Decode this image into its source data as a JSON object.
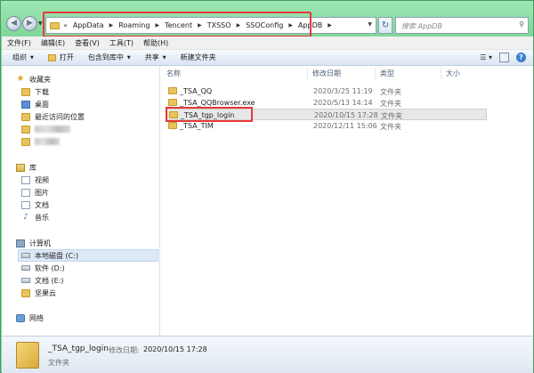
{
  "address": {
    "crumbs": [
      "AppData",
      "Roaming",
      "Tencent",
      "TXSSO",
      "SSOConfig",
      "AppDB"
    ],
    "search_placeholder": "搜索 AppDB"
  },
  "menubar": [
    "文件(F)",
    "编辑(E)",
    "查看(V)",
    "工具(T)",
    "帮助(H)"
  ],
  "toolbar": {
    "organize": "组织",
    "open": "打开",
    "include_in_library": "包含到库中",
    "share": "共享",
    "new_folder": "新建文件夹"
  },
  "nav": {
    "favorites": "收藏夹",
    "downloads": "下载",
    "desktop": "桌面",
    "recent": "最近访问的位置",
    "libraries": "库",
    "videos": "视频",
    "pictures": "图片",
    "documents": "文档",
    "music": "音乐",
    "computer": "计算机",
    "drive_c": "本地磁盘 (C:)",
    "drive_d": "软件 (D:)",
    "drive_e": "文档 (E:)",
    "nutstore": "坚果云",
    "network": "网络"
  },
  "columns": {
    "name": "名称",
    "modified": "修改日期",
    "type": "类型",
    "size": "大小"
  },
  "files": [
    {
      "name": "_TSA_QQ",
      "modified": "2020/3/25 11:19",
      "type": "文件夹"
    },
    {
      "name": "_TSA_QQBrowser.exe",
      "modified": "2020/5/13 14:14",
      "type": "文件夹"
    },
    {
      "name": "_TSA_tgp_login",
      "modified": "2020/10/15 17:28",
      "type": "文件夹",
      "selected": true
    },
    {
      "name": "_TSA_TIM",
      "modified": "2020/12/11 15:06",
      "type": "文件夹"
    }
  ],
  "details": {
    "name": "_TSA_tgp_login",
    "modified_label": "修改日期:",
    "modified_value": "2020/10/15 17:28",
    "type": "文件夹"
  },
  "colors": {
    "highlight": "#e53939",
    "frame": "#7fd798"
  }
}
